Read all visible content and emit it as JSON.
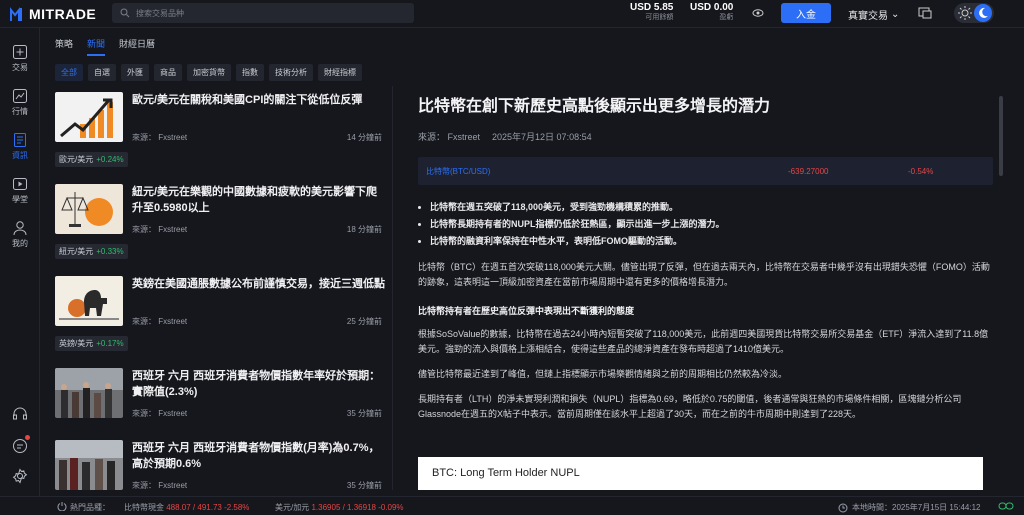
{
  "brand": {
    "name": "MITRADE"
  },
  "search": {
    "placeholder": "搜索交易品种"
  },
  "balance": [
    {
      "value": "USD 5.85",
      "label": "可用餘額"
    },
    {
      "value": "USD 0.00",
      "label": "盈虧"
    }
  ],
  "header": {
    "deposit": "入金",
    "account_mode": "真實交易"
  },
  "sidebar": {
    "items": [
      {
        "label": "交易",
        "icon": "plus-square-icon"
      },
      {
        "label": "行情",
        "icon": "chart-icon"
      },
      {
        "label": "資訊",
        "icon": "news-icon"
      },
      {
        "label": "學堂",
        "icon": "play-icon"
      },
      {
        "label": "我的",
        "icon": "user-icon"
      }
    ]
  },
  "tabs": [
    "策略",
    "新聞",
    "財經日曆"
  ],
  "categories": [
    "全部",
    "自選",
    "外匯",
    "商品",
    "加密貨幣",
    "指數",
    "技術分析",
    "財經指標"
  ],
  "news": [
    {
      "title": "歐元/美元在關稅和美國CPI的關注下從低位反彈",
      "source": "來源： Fxstreet",
      "time": "14 分鐘前",
      "tag": "歐元/美元",
      "change": "+0.24%"
    },
    {
      "title": "紐元/美元在樂觀的中國數據和疲軟的美元影響下爬升至0.5980以上",
      "source": "來源： Fxstreet",
      "time": "18 分鐘前",
      "tag": "紐元/美元",
      "change": "+0.33%"
    },
    {
      "title": "英鎊在美國通脹數據公布前謹慎交易，接近三週低點",
      "source": "來源： Fxstreet",
      "time": "25 分鐘前",
      "tag": "英鎊/美元",
      "change": "+0.17%"
    },
    {
      "title": "西班牙 六月 西班牙消費者物價指數年率好於預期：實際值(2.3%)",
      "source": "來源： Fxstreet",
      "time": "35 分鐘前"
    },
    {
      "title": "西班牙 六月 西班牙消費者物價指數(月率)為0.7%，高於預期0.6%",
      "source": "來源： Fxstreet",
      "time": "35 分鐘前"
    }
  ],
  "article": {
    "title": "比特幣在創下新歷史高點後顯示出更多增長的潛力",
    "source": "來源： Fxstreet",
    "date": "2025年7月12日 07:08:54",
    "quote": {
      "symbol": "比特幣(BTC/USD)",
      "price": "-639.27000",
      "pct": "-0.54%"
    },
    "bullets": [
      "比特幣在週五突破了118,000美元，受到強勁機構積累的推動。",
      "比特幣長期持有者的NUPL指標仍低於狂熱區，顯示出進一步上漲的潛力。",
      "比特幣的融資利率保持在中性水平，表明低FOMO驅動的活動。"
    ],
    "p1": "比特幣（BTC）在週五首次突破118,000美元大關。儘管出現了反彈，但在過去兩天內，比特幣在交易者中幾乎沒有出現錯失恐懼（FOMO）活動的跡象，這表明這一頂級加密資產在當前市場周期中還有更多的價格增長潛力。",
    "subhead": "比特幣持有者在歷史高位反彈中表現出不斷獲利的態度",
    "p2": "根據SoSoValue的數據，比特幣在過去24小時內短暫突破了118,000美元，此前週四美國現貨比特幣交易所交易基金（ETF）淨流入達到了11.8億美元。強勁的流入與價格上漲相結合，使得這些產品的總淨資產在發布時超過了1410億美元。",
    "p3": "儘管比特幣最近達到了峰值，但鏈上指標顯示市場樂觀情緒與之前的周期相比仍然較為冷淡。",
    "p4": "長期持有者（LTH）的淨未實現利潤和損失（NUPL）指標為0.69，略低於0.75的閾值，後者通常與狂熱的市場條件相關，區塊鏈分析公司Glassnode在週五的X帖子中表示。當前周期僅在該水平上超過了30天，而在之前的牛市周期中則達到了228天。",
    "image_caption": "BTC: Long Term Holder NUPL"
  },
  "footer": {
    "hot_label": "熱門品種：",
    "ticker1_name": "比特幣現金",
    "ticker1_vals": "488.07 / 491.73 -2.58%",
    "ticker2_name": "美元/加元",
    "ticker2_vals": "1.36905 / 1.36918 -0.09%",
    "clock": "本地時間：2025年7月15日 15:44:12"
  }
}
